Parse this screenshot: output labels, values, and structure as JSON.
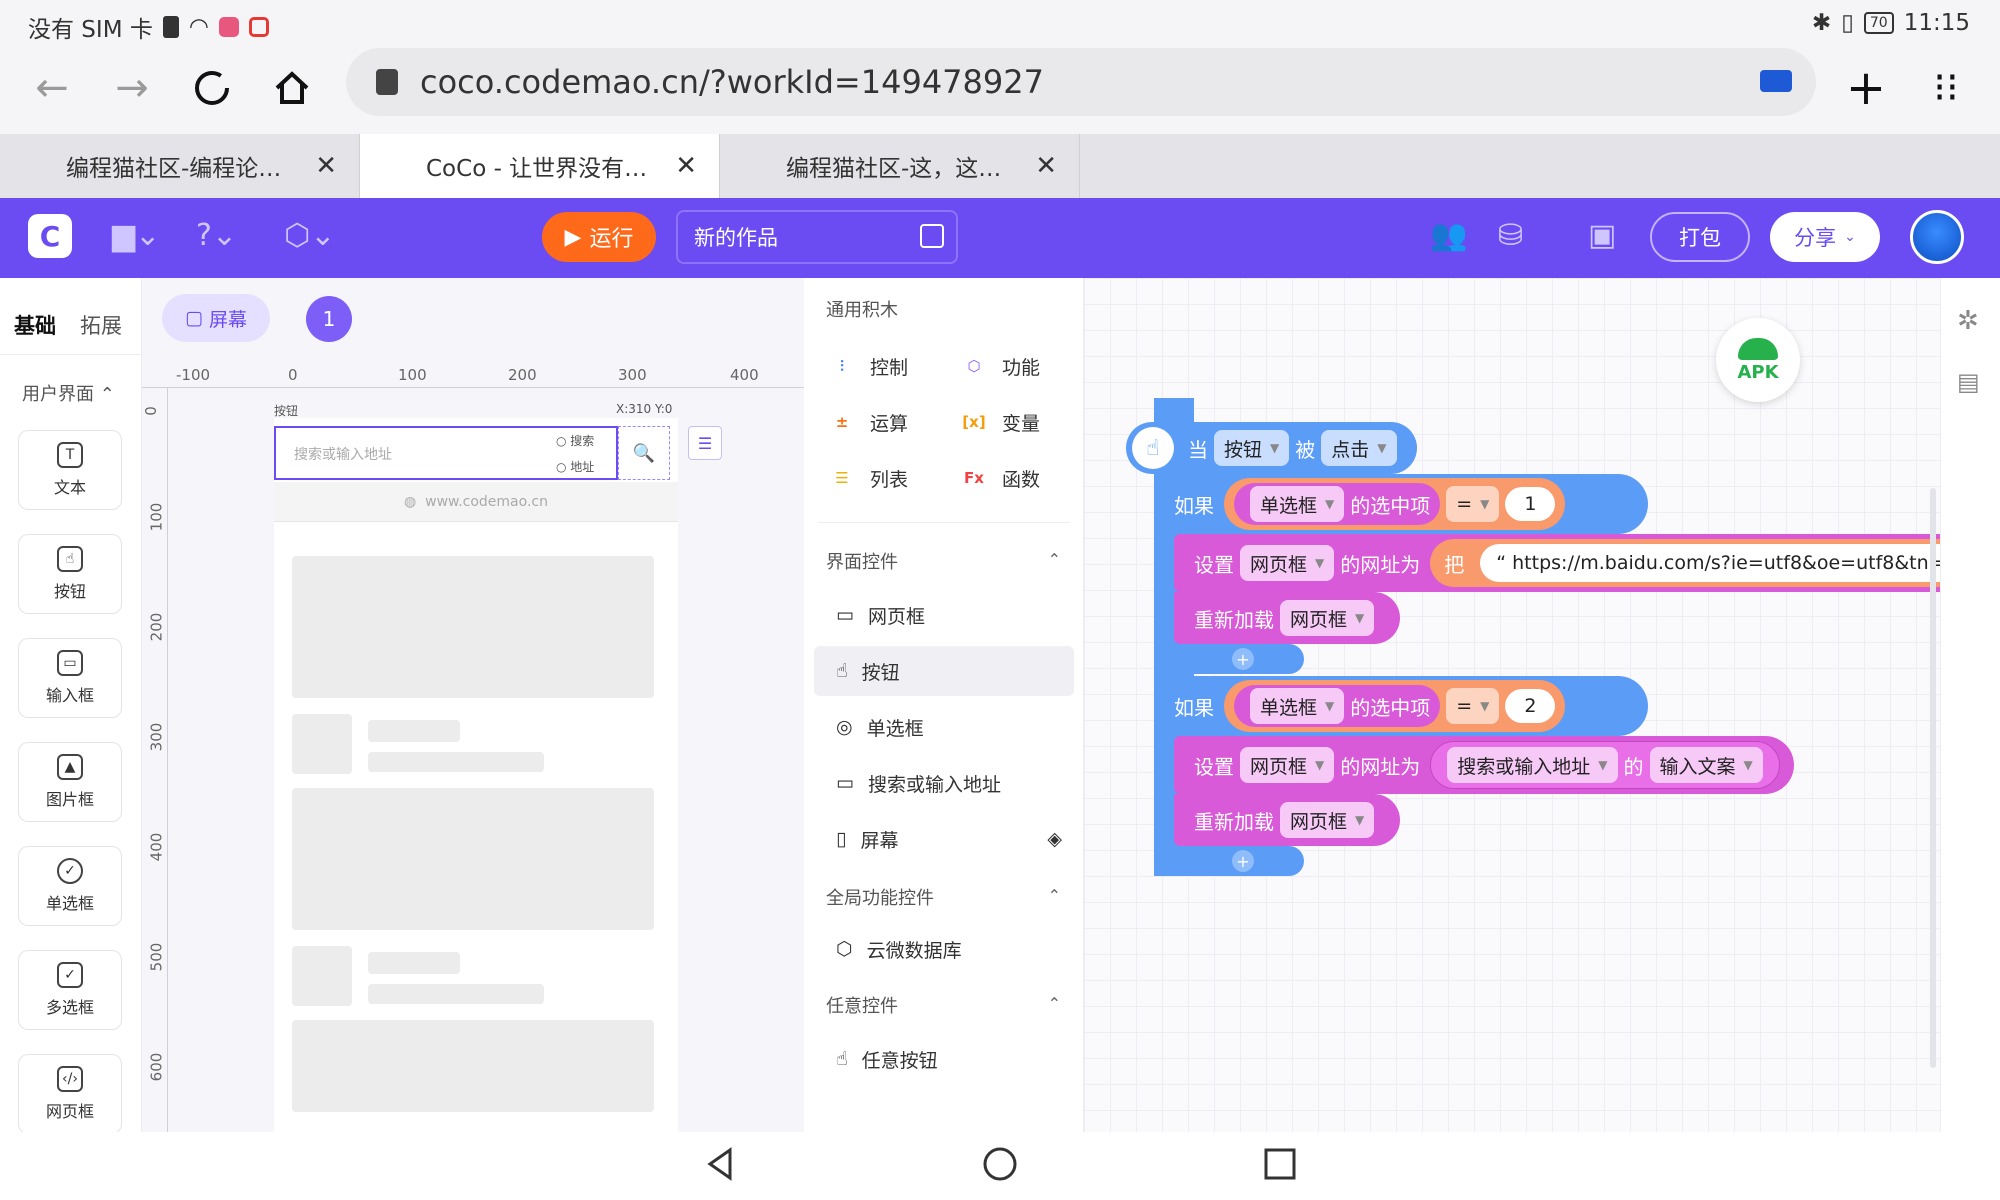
{
  "status_bar": {
    "carrier": "没有 SIM 卡",
    "battery": "70",
    "time": "11:15"
  },
  "browser": {
    "url": "coco.codemao.cn/?workId=149478927"
  },
  "tabs": [
    {
      "title": "编程猫社区-编程论…",
      "close": "✕"
    },
    {
      "title": "CoCo - 让世界没有…",
      "close": "✕"
    },
    {
      "title": "编程猫社区-这，这…",
      "close": "✕"
    }
  ],
  "header": {
    "run_label": "运行",
    "project_title": "新的作品",
    "package_label": "打包",
    "share_label": "分享",
    "brand_color": "#6a4cf2",
    "run_color": "#ff6a1a"
  },
  "sidebar": {
    "tabs": [
      "基础",
      "拓展"
    ],
    "section": "用户界面",
    "components": [
      "文本",
      "按钮",
      "输入框",
      "图片框",
      "单选框",
      "多选框",
      "网页框"
    ]
  },
  "canvas": {
    "screen_label": "屏幕",
    "screen_number": "1",
    "ruler_h": [
      "-100",
      "0",
      "100",
      "200",
      "300",
      "400"
    ],
    "ruler_v": [
      "0",
      "100",
      "200",
      "300",
      "400",
      "500",
      "600"
    ],
    "widget_label": "按钮",
    "coord_readout": "X:310 Y:0",
    "search_placeholder": "搜索或输入地址",
    "radio_search": "搜索",
    "radio_address": "地址",
    "site_url": "www.codemao.cn"
  },
  "palette": {
    "general_heading": "通用积木",
    "general": [
      {
        "label": "控制",
        "icon": "control-icon"
      },
      {
        "label": "功能",
        "icon": "function-icon"
      },
      {
        "label": "运算",
        "icon": "operator-icon"
      },
      {
        "label": "变量",
        "icon": "variable-icon"
      },
      {
        "label": "列表",
        "icon": "list-icon"
      },
      {
        "label": "函数",
        "icon": "fx-icon"
      }
    ],
    "ui_heading": "界面控件",
    "ui_items": [
      "网页框",
      "按钮",
      "单选框",
      "搜索或输入地址",
      "屏幕"
    ],
    "global_heading": "全局功能控件",
    "global_items": [
      "云微数据库"
    ],
    "any_heading": "任意控件",
    "any_items": [
      "任意按钮"
    ]
  },
  "workspace": {
    "apk_label": "APK",
    "event": {
      "when": "当",
      "target": "按钮",
      "was": "被",
      "action": "点击"
    },
    "if1": {
      "if": "如果",
      "obj": "单选框",
      "prop": "的选中项",
      "op": "=",
      "value": "1"
    },
    "set1": {
      "set": "设置",
      "obj": "网页框",
      "prop": "的网址为",
      "ba": "把",
      "url": "https://m.baidu.com/s?ie=utf8&oe=utf8&tn="
    },
    "reload1": {
      "label": "重新加载",
      "obj": "网页框"
    },
    "if2": {
      "if": "如果",
      "obj": "单选框",
      "prop": "的选中项",
      "op": "=",
      "value": "2"
    },
    "set2": {
      "set": "设置",
      "obj": "网页框",
      "prop": "的网址为",
      "src": "搜索或输入地址",
      "of": "的",
      "field": "输入文案"
    },
    "reload2": {
      "label": "重新加载",
      "obj": "网页框"
    }
  }
}
